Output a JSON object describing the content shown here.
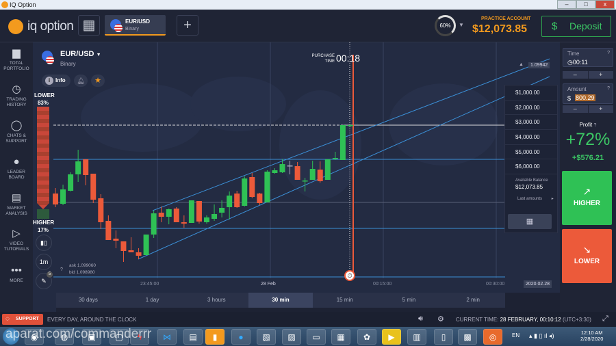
{
  "window": {
    "title": "IQ Option",
    "min": "–",
    "max": "□",
    "close": "x"
  },
  "header": {
    "logo": "iq option",
    "asset_tab": {
      "name": "EUR/USD",
      "type": "Binary"
    },
    "add": "+",
    "grid_icon": "grid-icon",
    "level": "60%",
    "account_label": "PRACTICE ACCOUNT",
    "balance": "$12,073.85",
    "deposit": "Deposit"
  },
  "sidebar": [
    {
      "label": "TOTAL PORTFOLIO",
      "icon": "briefcase"
    },
    {
      "label": "TRADING HISTORY",
      "icon": "history"
    },
    {
      "label": "CHATS & SUPPORT",
      "icon": "chat"
    },
    {
      "label": "LEADER BOARD",
      "icon": "medal"
    },
    {
      "label": "MARKET ANALYSIS",
      "icon": "news"
    },
    {
      "label": "VIDEO TUTORIALS",
      "icon": "play"
    },
    {
      "label": "MORE",
      "icon": "dots"
    }
  ],
  "asset": {
    "name": "EUR/USD",
    "type": "Binary",
    "info": "Info"
  },
  "sentiment": {
    "lower_label": "LOWER",
    "lower_pct": "83%",
    "higher_label": "HIGHER",
    "higher_pct": "17%",
    "lower_fraction": 0.83
  },
  "chart_tools": {
    "interval": "1m",
    "drawings_count": "5"
  },
  "quotes": {
    "ask": "ask 1.099060",
    "bid": "bid 1.098980"
  },
  "purchase": {
    "label1": "PURCHASE",
    "label2": "TIME",
    "countdown": "00:18"
  },
  "price_label": "1.09942",
  "x_axis": [
    "23:45:00",
    "28 Feb",
    "00:15:00",
    "00:30:00"
  ],
  "date_label": "2020.02.28",
  "timeframes": [
    "30 days",
    "1 day",
    "3 hours",
    "30 min",
    "15 min",
    "5 min",
    "2 min"
  ],
  "active_timeframe": "30 min",
  "amount_dropdown": {
    "options": [
      "$1,000.00",
      "$2,000.00",
      "$3,000.00",
      "$4,000.00",
      "$5,000.00",
      "$6,000.00"
    ],
    "available_label": "Available Balance",
    "available": "$12,073.85",
    "last_amounts": "Last amounts"
  },
  "trade": {
    "time_label": "Time",
    "time": "00:11",
    "amount_label": "Amount",
    "currency": "$",
    "amount": "800.29",
    "minus": "–",
    "plus": "+",
    "profit_label": "Profit",
    "profit_pct": "+72%",
    "profit_value": "+$576.21",
    "higher": "HIGHER",
    "lower": "LOWER"
  },
  "footer": {
    "support": "SUPPORT",
    "tagline": "EVERY DAY, AROUND THE CLOCK",
    "current_time_label": "CURRENT TIME:",
    "current_time": "28 FEBRUARY, 00:10:12",
    "tz": "(UTC+3:30)"
  },
  "taskbar": {
    "lang": "EN",
    "clock": "12:10 AM",
    "date": "2/28/2020",
    "watermark": "aparat.com/commanderrr"
  },
  "colors": {
    "up": "#2fc155",
    "down": "#ec5a3a",
    "accent": "#f39a1e",
    "line": "#3b8fd6"
  },
  "chart_data": {
    "type": "candlestick",
    "unit": "relative price index",
    "candles": [
      [
        117,
        125,
        97,
        101
      ],
      [
        102,
        130,
        100,
        123
      ],
      [
        121,
        148,
        120,
        145
      ],
      [
        145,
        181,
        134,
        164
      ],
      [
        167,
        167,
        129,
        144
      ],
      [
        146,
        146,
        103,
        108
      ],
      [
        110,
        116,
        65,
        75
      ],
      [
        77,
        85,
        49,
        49
      ],
      [
        51,
        63,
        37,
        48
      ],
      [
        47,
        47,
        17,
        33
      ],
      [
        34,
        53,
        31,
        31
      ],
      [
        31,
        37,
        21,
        26
      ],
      [
        27,
        57,
        27,
        57
      ],
      [
        57,
        92,
        52,
        88
      ],
      [
        89,
        98,
        75,
        83
      ],
      [
        83,
        95,
        72,
        94
      ],
      [
        95,
        97,
        75,
        75
      ],
      [
        75,
        85,
        67,
        73
      ],
      [
        74,
        107,
        74,
        107
      ],
      [
        106,
        106,
        73,
        76
      ],
      [
        75,
        85,
        73,
        82
      ],
      [
        80,
        101,
        77,
        87
      ],
      [
        89,
        107,
        82,
        96
      ],
      [
        97,
        120,
        79,
        114
      ],
      [
        117,
        121,
        96,
        97
      ],
      [
        99,
        142,
        98,
        139
      ],
      [
        141,
        147,
        110,
        112
      ],
      [
        117,
        118,
        100,
        103
      ],
      [
        104,
        151,
        104,
        149
      ],
      [
        147,
        154,
        146,
        151
      ],
      [
        148,
        167,
        147,
        160
      ],
      [
        158,
        165,
        145,
        158
      ],
      [
        157,
        163,
        137,
        137
      ],
      [
        135,
        140,
        120,
        136
      ],
      [
        137,
        165,
        137,
        153
      ],
      [
        152,
        164,
        133,
        135
      ],
      [
        137,
        167,
        137,
        167
      ],
      [
        168,
        178,
        166,
        169
      ],
      [
        166,
        217,
        166,
        217
      ],
      [
        216,
        218,
        215,
        217
      ]
    ],
    "levels": [
      217,
      167,
      104,
      66,
      -5
    ]
  }
}
